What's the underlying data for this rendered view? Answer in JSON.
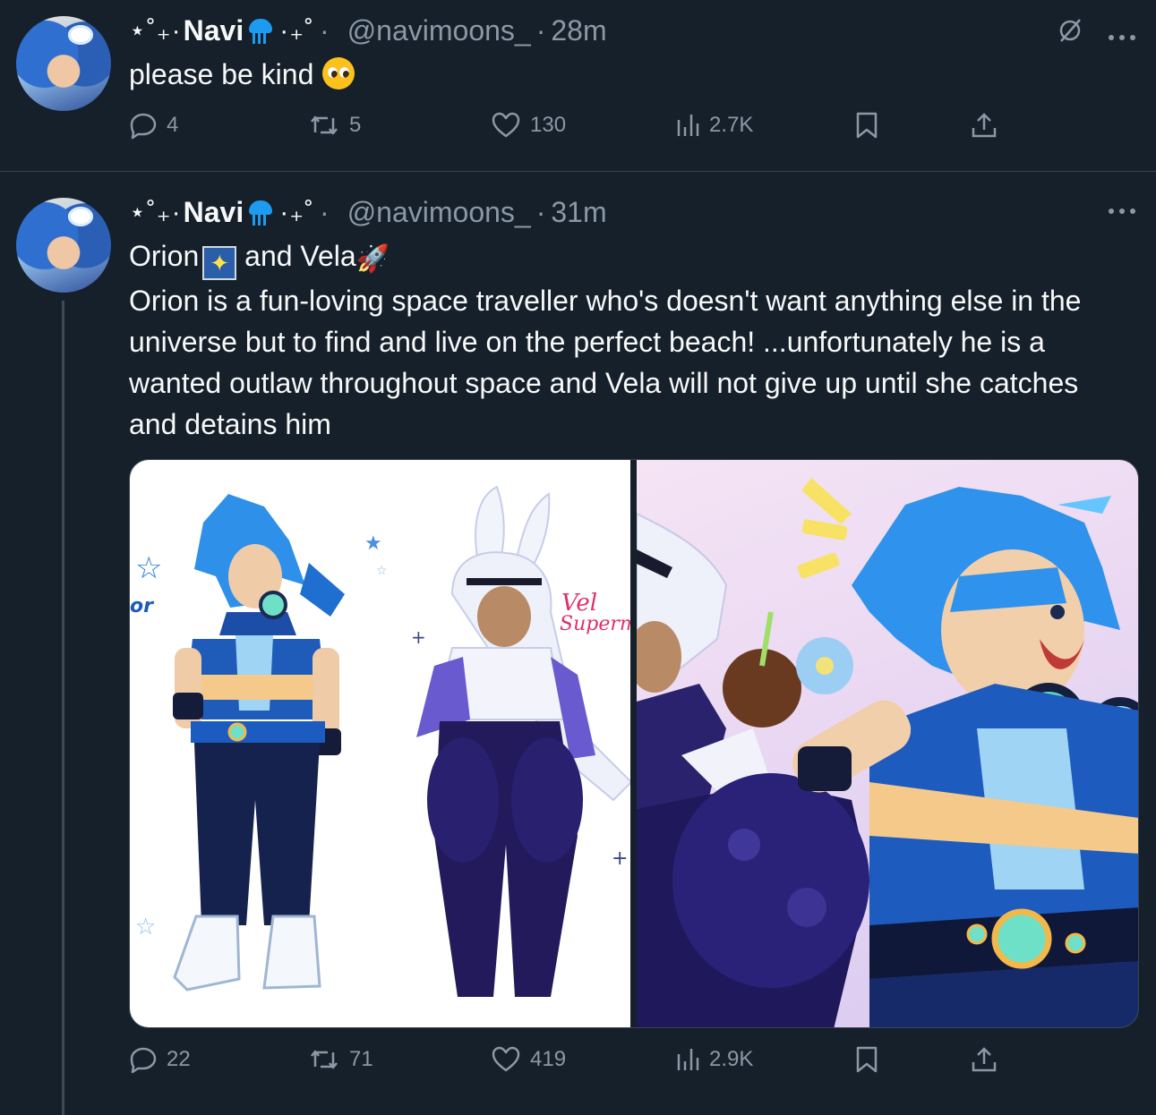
{
  "tweets": [
    {
      "name_prefix": "⋆˚₊·",
      "name": "Navi",
      "name_suffix": "·₊˚",
      "handle": "@navimoons_",
      "time": "28m",
      "text": "please be kind",
      "replies": "4",
      "reposts": "5",
      "likes": "130",
      "views": "2.7K"
    },
    {
      "name_prefix": "⋆˚₊·",
      "name": "Navi",
      "name_suffix": "·₊˚",
      "handle": "@navimoons_",
      "time": "31m",
      "text_line1_a": "Orion",
      "text_line1_b": " and Vela",
      "text_body": "Orion is a fun-loving space traveller who's doesn't want anything else in the universe but to find and live on the perfect beach! ...unfortunately he is a wanted outlaw throughout space and Vela will not give up until she catches and detains him",
      "media_left_sign_1": "Vel",
      "media_left_sign_2": "Superm",
      "replies": "22",
      "reposts": "71",
      "likes": "419",
      "views": "2.9K"
    }
  ],
  "separator": "·",
  "icons": {
    "reply": "reply-icon",
    "repost": "repost-icon",
    "like": "heart-icon",
    "views": "views-icon",
    "bookmark": "bookmark-icon",
    "share": "share-icon",
    "more": "more-icon",
    "muted": "mute-icon"
  },
  "colors": {
    "background": "#15202b",
    "text": "#f7f9f9",
    "secondary": "#8b98a5",
    "divider": "#38444d",
    "accent": "#1d9bf0"
  }
}
